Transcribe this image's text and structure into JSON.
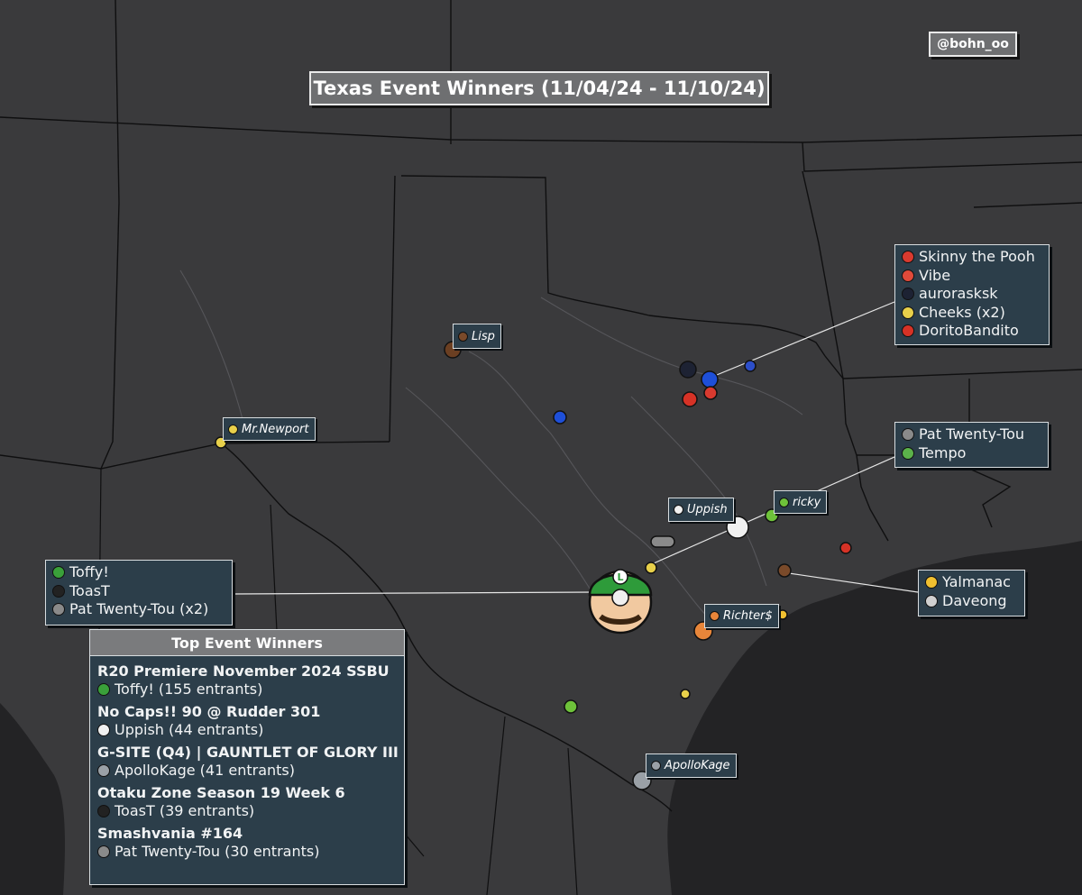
{
  "title": "Texas Event Winners (11/04/24 - 11/10/24)",
  "credit": "@bohn_oo",
  "colors": {
    "background": "#3a3a3c",
    "water": "#232325",
    "box": "#2c3e4a",
    "title_box": "#6e6f71",
    "borders": "#111111",
    "rivers": "#555558"
  },
  "callouts": [
    {
      "id": "dfw",
      "entries": [
        {
          "name": "Skinny the Pooh",
          "icon": "red-cap-icon",
          "color": "#d93a2f"
        },
        {
          "name": "Vibe",
          "icon": "red-cap-icon",
          "color": "#e04a3a"
        },
        {
          "name": "aurorasksk",
          "icon": "dark-hair-icon",
          "color": "#1d2233"
        },
        {
          "name": "Cheeks (x2)",
          "icon": "yellow-spiky-icon",
          "color": "#e8d04a"
        },
        {
          "name": "DoritoBandito",
          "icon": "red-cap-icon",
          "color": "#d63226"
        }
      ]
    },
    {
      "id": "houston-north",
      "entries": [
        {
          "name": "Pat Twenty-Tou",
          "icon": "gray-robot-icon",
          "color": "#8a8a8a"
        },
        {
          "name": "Tempo",
          "icon": "green-dino-icon",
          "color": "#5bb24a"
        }
      ]
    },
    {
      "id": "houston-south",
      "entries": [
        {
          "name": "Yalmanac",
          "icon": "blonde-hair-icon",
          "color": "#f0c030"
        },
        {
          "name": "Daveong",
          "icon": "white-hair-icon",
          "color": "#d0d0d0"
        }
      ]
    },
    {
      "id": "austin",
      "entries": [
        {
          "name": "Toffy!",
          "icon": "green-cap-icon",
          "color": "#3aa03a"
        },
        {
          "name": "ToasT",
          "icon": "black-mask-icon",
          "color": "#222222"
        },
        {
          "name": "Pat Twenty-Tou (x2)",
          "icon": "gray-robot-icon",
          "color": "#8a8a8a"
        }
      ]
    }
  ],
  "tags": [
    {
      "name": "Lisp",
      "icon": "brown-hair-icon",
      "color": "#7a4a2a"
    },
    {
      "name": "Mr.Newport",
      "icon": "yellow-spiky-icon",
      "color": "#e8d04a"
    },
    {
      "name": "Uppish",
      "icon": "white-fluff-icon",
      "color": "#f0f0f0"
    },
    {
      "name": "ricky",
      "icon": "green-goo-icon",
      "color": "#6ec23a"
    },
    {
      "name": "Richter$",
      "icon": "orange-hair-icon",
      "color": "#e8863a"
    },
    {
      "name": "ApolloKage",
      "icon": "gray-helmet-icon",
      "color": "#9aa0a6"
    }
  ],
  "top_events": {
    "header": "Top Event Winners",
    "events": [
      {
        "title": "R20 Premiere November 2024 SSBU",
        "winner": "Toffy! (155 entrants)",
        "icon": "green-cap-icon",
        "color": "#3aa03a"
      },
      {
        "title": "No Caps!! 90 @ Rudder 301",
        "winner": "Uppish (44 entrants)",
        "icon": "white-fluff-icon",
        "color": "#f0f0f0"
      },
      {
        "title": "G-SITE (Q4) | GAUNTLET OF GLORY III",
        "winner": "ApolloKage (41 entrants)",
        "icon": "gray-helmet-icon",
        "color": "#9aa0a6"
      },
      {
        "title": "Otaku Zone Season 19 Week 6",
        "winner": "ToasT (39 entrants)",
        "icon": "black-mask-icon",
        "color": "#222222"
      },
      {
        "title": "Smashvania #164",
        "winner": "Pat Twenty-Tou (30 entrants)",
        "icon": "gray-robot-icon",
        "color": "#8a8a8a"
      }
    ]
  },
  "map_markers": [
    {
      "name": "luigi-marker",
      "icon": "luigi-icon",
      "color": "#3aa03a"
    },
    {
      "name": "sonic-marker",
      "icon": "blue-spiky-icon",
      "color": "#1e4fd8"
    },
    {
      "name": "falco-marker",
      "icon": "blue-bird-icon",
      "color": "#2c4ec9"
    },
    {
      "name": "mario-marker",
      "icon": "red-cap-icon",
      "color": "#d63226"
    },
    {
      "name": "kirby-marker",
      "icon": "pink-ball-icon",
      "color": "#e8a4b8"
    }
  ]
}
